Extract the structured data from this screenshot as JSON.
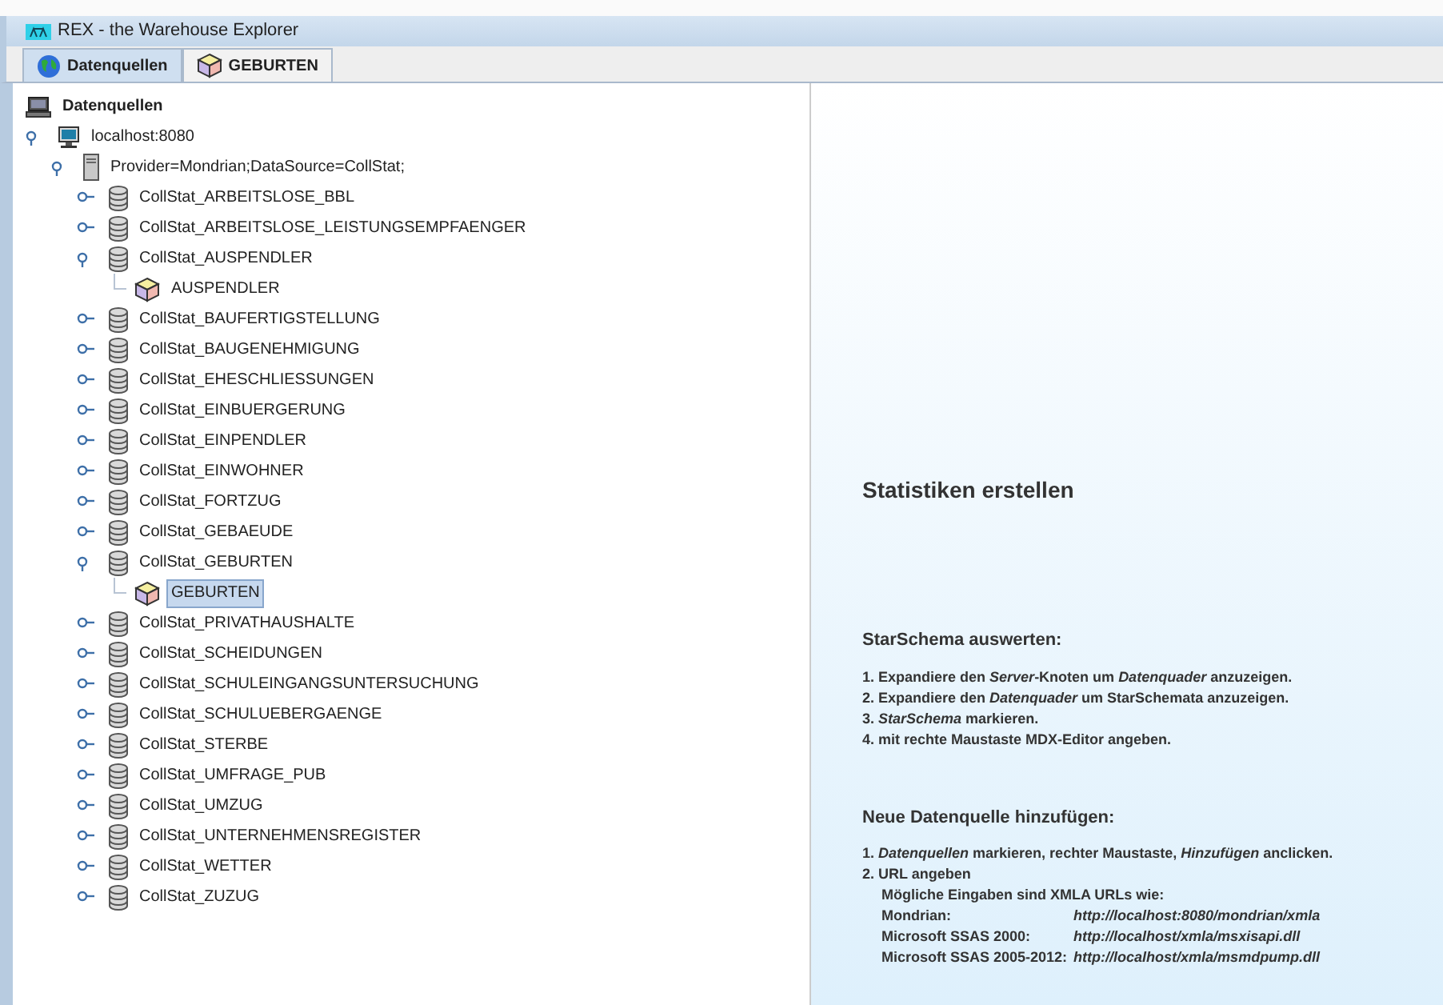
{
  "window": {
    "title": "REX - the Warehouse Explorer"
  },
  "tabs": [
    {
      "label": "Datenquellen",
      "kind": "globe",
      "selected": true
    },
    {
      "label": "GEBURTEN",
      "kind": "cube",
      "selected": false
    }
  ],
  "tree": {
    "label": "Datenquellen",
    "kind": "root",
    "selected": false,
    "children": [
      {
        "label": "localhost:8080",
        "kind": "server",
        "expanded": true,
        "selected": false,
        "children": [
          {
            "label": "Provider=Mondrian;DataSource=CollStat;",
            "kind": "provider",
            "expanded": true,
            "selected": false,
            "children": [
              {
                "label": "CollStat_ARBEITSLOSE_BBL",
                "kind": "database",
                "expanded": false,
                "selected": false
              },
              {
                "label": "CollStat_ARBEITSLOSE_LEISTUNGSEMPFAENGER",
                "kind": "database",
                "expanded": false,
                "selected": false
              },
              {
                "label": "CollStat_AUSPENDLER",
                "kind": "database",
                "expanded": true,
                "selected": false,
                "children": [
                  {
                    "label": "AUSPENDLER",
                    "kind": "cube",
                    "selected": false
                  }
                ]
              },
              {
                "label": "CollStat_BAUFERTIGSTELLUNG",
                "kind": "database",
                "expanded": false,
                "selected": false
              },
              {
                "label": "CollStat_BAUGENEHMIGUNG",
                "kind": "database",
                "expanded": false,
                "selected": false
              },
              {
                "label": "CollStat_EHESCHLIESSUNGEN",
                "kind": "database",
                "expanded": false,
                "selected": false
              },
              {
                "label": "CollStat_EINBUERGERUNG",
                "kind": "database",
                "expanded": false,
                "selected": false
              },
              {
                "label": "CollStat_EINPENDLER",
                "kind": "database",
                "expanded": false,
                "selected": false
              },
              {
                "label": "CollStat_EINWOHNER",
                "kind": "database",
                "expanded": false,
                "selected": false
              },
              {
                "label": "CollStat_FORTZUG",
                "kind": "database",
                "expanded": false,
                "selected": false
              },
              {
                "label": "CollStat_GEBAEUDE",
                "kind": "database",
                "expanded": false,
                "selected": false
              },
              {
                "label": "CollStat_GEBURTEN",
                "kind": "database",
                "expanded": true,
                "selected": false,
                "children": [
                  {
                    "label": "GEBURTEN",
                    "kind": "cube",
                    "selected": true
                  }
                ]
              },
              {
                "label": "CollStat_PRIVATHAUSHALTE",
                "kind": "database",
                "expanded": false,
                "selected": false
              },
              {
                "label": "CollStat_SCHEIDUNGEN",
                "kind": "database",
                "expanded": false,
                "selected": false
              },
              {
                "label": "CollStat_SCHULEINGANGSUNTERSUCHUNG",
                "kind": "database",
                "expanded": false,
                "selected": false
              },
              {
                "label": "CollStat_SCHULUEBERGAENGE",
                "kind": "database",
                "expanded": false,
                "selected": false
              },
              {
                "label": "CollStat_STERBE",
                "kind": "database",
                "expanded": false,
                "selected": false
              },
              {
                "label": "CollStat_UMFRAGE_PUB",
                "kind": "database",
                "expanded": false,
                "selected": false
              },
              {
                "label": "CollStat_UMZUG",
                "kind": "database",
                "expanded": false,
                "selected": false
              },
              {
                "label": "CollStat_UNTERNEHMENSREGISTER",
                "kind": "database",
                "expanded": false,
                "selected": false
              },
              {
                "label": "CollStat_WETTER",
                "kind": "database",
                "expanded": false,
                "selected": false
              },
              {
                "label": "CollStat_ZUZUG",
                "kind": "database",
                "expanded": false,
                "selected": false
              }
            ]
          }
        ]
      }
    ]
  },
  "help": {
    "title": "Statistiken erstellen",
    "sections": [
      {
        "heading": "StarSchema auswerten:",
        "steps": [
          "1. Expandiere den *Server*-Knoten um *Datenquader* anzuzeigen.",
          "2. Expandiere den *Datenquader* um StarSchemata anzuzeigen.",
          "3. *StarSchema* markieren.",
          "4. mit rechte Maustaste MDX-Editor angeben."
        ]
      },
      {
        "heading": "Neue Datenquelle hinzufügen:",
        "steps": [
          "1. *Datenquellen* markieren, rechter Maustaste, *Hinzufügen* anclicken.",
          "2. URL angeben"
        ],
        "note": "Mögliche Eingaben sind XMLA URLs wie:",
        "urls": [
          {
            "label": "Mondrian:",
            "url": "http://localhost:8080/mondrian/xmla"
          },
          {
            "label": "Microsoft SSAS 2000:",
            "url": "http://localhost/xmla/msxisapi.dll"
          },
          {
            "label": "Microsoft SSAS 2005-2012:",
            "url": "http://localhost/xmla/msmdpump.dll"
          }
        ]
      }
    ]
  }
}
